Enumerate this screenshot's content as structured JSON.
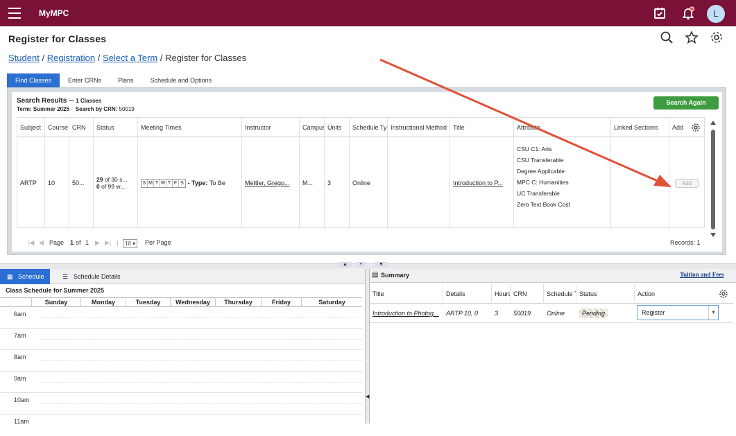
{
  "topbar": {
    "brand": "MyMPC",
    "avatar_initial": "L"
  },
  "page": {
    "title": "Register for Classes"
  },
  "breadcrumb": {
    "student": "Student",
    "registration": "Registration",
    "select_term": "Select a Term",
    "current": "Register for Classes",
    "sep": "/"
  },
  "tabs": [
    "Find Classes",
    "Enter CRNs",
    "Plans",
    "Schedule and Options"
  ],
  "search": {
    "title": "Search Results",
    "count": "— 1 Classes",
    "term_label": "Term:",
    "term": "Summer 2025",
    "crn_label": "Search by CRN:",
    "crn": "50019",
    "search_again": "Search Again"
  },
  "grid": {
    "headers": [
      "Subject",
      "Course",
      "CRN",
      "Status",
      "Meeting Times",
      "Instructor",
      "Campus",
      "Units",
      "Schedule Type",
      "Instructional Method",
      "Title",
      "Attribute",
      "Linked Sections",
      "Add"
    ],
    "row": {
      "subject": "ARTP",
      "course": "10",
      "crn": "50...",
      "status_seats": "29",
      "status_of": "of 30 s...",
      "status_wait": "0",
      "status_wait_of": "of 99 w...",
      "days": [
        "S",
        "M",
        "T",
        "W",
        "T",
        "F",
        "S"
      ],
      "type_label": "- Type:",
      "type_value": "To Be",
      "instructor": "Mettler, Grego...",
      "campus": "M...",
      "units": "3",
      "schedule_type": "Online",
      "title": "Introduction to P...",
      "attributes": [
        "CSU C1: Arts",
        "CSU Transferable",
        "Degree Applicable",
        "MPC C: Humanities",
        "UC Transferable",
        "Zero Text Book Cost"
      ],
      "add": "Add"
    }
  },
  "pager": {
    "page_label": "Page",
    "page": "1",
    "of_label": "of",
    "total": "1",
    "per_page": "10",
    "per_page_label": "Per Page",
    "records_label": "Records:",
    "records": "1"
  },
  "schedule": {
    "tab_schedule": "Schedule",
    "tab_details": "Schedule Details",
    "title": "Class Schedule for Summer 2025",
    "days": [
      "Sunday",
      "Monday",
      "Tuesday",
      "Wednesday",
      "Thursday",
      "Friday",
      "Saturday"
    ],
    "hours": [
      "6am",
      "7am",
      "8am",
      "9am",
      "10am",
      "11am"
    ]
  },
  "summary": {
    "title": "Summary",
    "tuition": "Tuition and Fees",
    "headers": [
      "Title",
      "Details",
      "Hours",
      "CRN",
      "Schedule Type",
      "Status",
      "Action"
    ],
    "row": {
      "title": "Introduction to Photog...",
      "details": "ARTP 10, 0",
      "hours": "3",
      "crn": "50019",
      "schedule": "Online",
      "status": "Pending",
      "action": "Register"
    }
  },
  "colors": {
    "brand": "#7a1136",
    "tab_active": "#2a6fd1",
    "search_again": "#3f9b3f",
    "arrow": "#e0513a"
  }
}
